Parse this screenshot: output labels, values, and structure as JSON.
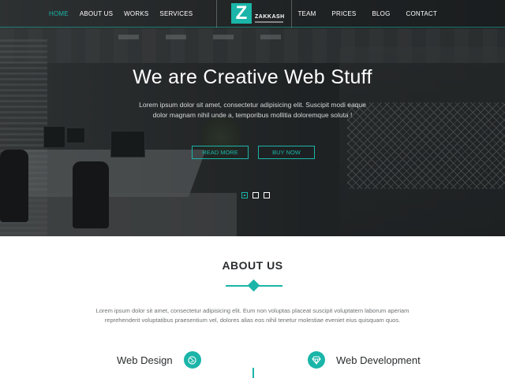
{
  "nav": {
    "left": [
      "HOME",
      "ABOUT US",
      "WORKS",
      "SERVICES"
    ],
    "right": [
      "TEAM",
      "PRICES",
      "BLOG",
      "CONTACT"
    ],
    "logo_letter": "Z",
    "logo_text": "ZAKKASH"
  },
  "hero": {
    "title": "We are Creative Web Stuff",
    "subtitle": "Lorem ipsum dolor sit amet, consectetur adipisicing elit. Suscipit modi eaque dolor magnam nihil unde a, temporibus mollitia doloremque soluta !",
    "read_more": "READ MORE",
    "buy_now": "BUY NOW",
    "slides": 3,
    "active_slide": 1
  },
  "about": {
    "title": "ABOUT US",
    "text": "Lorem ipsum dolor sit amet, consectetur adipisicing elit. Eum non voluptas placeat suscipit voluptatem laborum aperiam reprehenderit voluptatibus praesentium vel, dolores alias eos nihil tenetur molestiae eveniet eius quisquam quos.",
    "features": [
      {
        "label": "Web Design",
        "icon": "globe-icon"
      },
      {
        "label": "Web Development",
        "icon": "diamond-icon"
      }
    ]
  },
  "colors": {
    "accent": "#1ab5a8",
    "text_dark": "#2a2d2f",
    "text_muted": "#6e7173"
  }
}
